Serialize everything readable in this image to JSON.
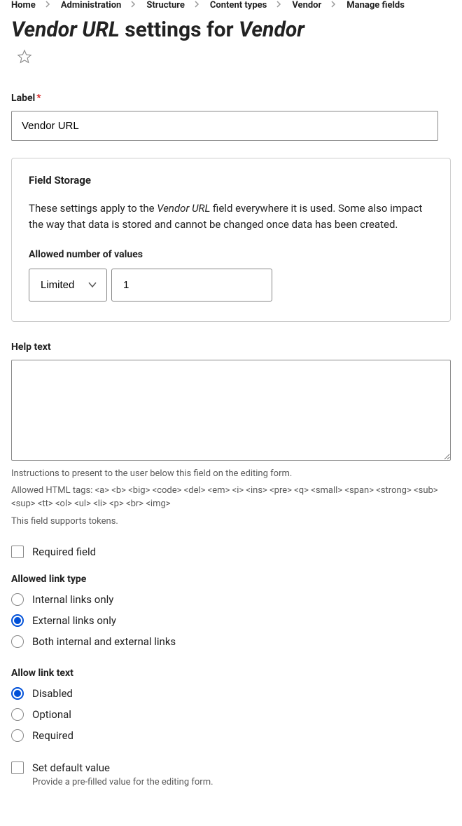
{
  "breadcrumb": {
    "items": [
      {
        "label": "Home"
      },
      {
        "label": "Administration"
      },
      {
        "label": "Structure"
      },
      {
        "label": "Content types"
      },
      {
        "label": "Vendor"
      },
      {
        "label": "Manage fields"
      }
    ]
  },
  "page_title": {
    "field_name": "Vendor URL",
    "middle": " settings for ",
    "content_type": "Vendor"
  },
  "label_field": {
    "label": "Label",
    "value": "Vendor URL"
  },
  "field_storage": {
    "legend": "Field Storage",
    "desc_prefix": "These settings apply to the ",
    "desc_em": "Vendor URL",
    "desc_suffix": " field everywhere it is used. Some also impact the way that data is stored and cannot be changed once data has been created.",
    "allowed_label": "Allowed number of values",
    "select_value": "Limited",
    "number_value": "1"
  },
  "help_text": {
    "label": "Help text",
    "value": "",
    "desc1": "Instructions to present to the user below this field on the editing form.",
    "desc2": "Allowed HTML tags: <a> <b> <big> <code> <del> <em> <i> <ins> <pre> <q> <small> <span> <strong> <sub> <sup> <tt> <ol> <ul> <li> <p> <br> <img>",
    "desc3": "This field supports tokens."
  },
  "required_checkbox": {
    "label": "Required field",
    "checked": false
  },
  "link_type": {
    "title": "Allowed link type",
    "options": [
      {
        "label": "Internal links only",
        "checked": false
      },
      {
        "label": "External links only",
        "checked": true
      },
      {
        "label": "Both internal and external links",
        "checked": false
      }
    ]
  },
  "link_text": {
    "title": "Allow link text",
    "options": [
      {
        "label": "Disabled",
        "checked": true
      },
      {
        "label": "Optional",
        "checked": false
      },
      {
        "label": "Required",
        "checked": false
      }
    ]
  },
  "default_value": {
    "label": "Set default value",
    "checked": false,
    "desc": "Provide a pre-filled value for the editing form."
  }
}
